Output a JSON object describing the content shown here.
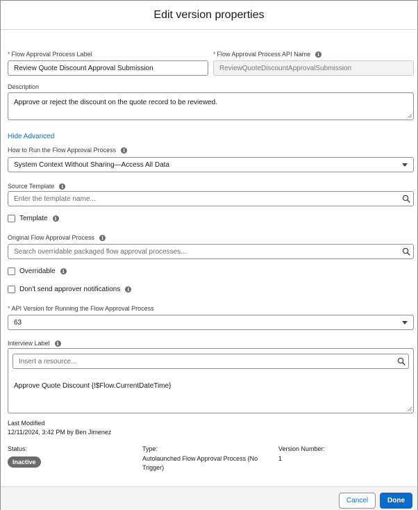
{
  "dialog": {
    "title": "Edit version properties"
  },
  "form": {
    "label_field": {
      "label": "Flow Approval Process Label",
      "value": "Review Quote Discount Approval Submission"
    },
    "api_name_field": {
      "label": "Flow Approval Process API Name",
      "value": "ReviewQuoteDiscountApprovalSubmission"
    },
    "description": {
      "label": "Description",
      "value": "Approve or reject the discount on the quote record to be reviewed."
    },
    "hide_advanced": "Hide Advanced",
    "how_to_run": {
      "label": "How to Run the Flow Approval Process",
      "value": "System Context Without Sharing—Access All Data"
    },
    "source_template": {
      "label": "Source Template",
      "placeholder": "Enter the template name..."
    },
    "template_checkbox": {
      "label": "Template",
      "checked": false
    },
    "original_process": {
      "label": "Original Flow Approval Process",
      "placeholder": "Search overridable packaged flow approval processes..."
    },
    "overridable_checkbox": {
      "label": "Overridable",
      "checked": false
    },
    "no_notifications_checkbox": {
      "label": "Don't send approver notifications",
      "checked": false
    },
    "api_version": {
      "label": "API Version for Running the Flow Approval Process",
      "value": "63"
    },
    "interview_label": {
      "label": "Interview Label",
      "resource_placeholder": "Insert a resource...",
      "value": "Approve Quote Discount {!$Flow.CurrentDateTime}"
    }
  },
  "meta": {
    "last_modified_label": "Last Modified",
    "last_modified_value": "12/11/2024, 3:42 PM by Ben Jimenez",
    "status_label": "Status:",
    "status_value": "Inactive",
    "type_label": "Type:",
    "type_value_line1": "Autolaunched Flow Approval Process (No",
    "type_value_line2": "Trigger)",
    "version_label": "Version Number:",
    "version_value": "1"
  },
  "footer": {
    "cancel": "Cancel",
    "done": "Done"
  },
  "colors": {
    "brand": "#0b6bcb",
    "required": "#c23934",
    "badge": "#6b6b6b"
  },
  "icons": [
    "info-icon",
    "search-icon",
    "chevron-down-icon",
    "resize-handle-icon"
  ]
}
